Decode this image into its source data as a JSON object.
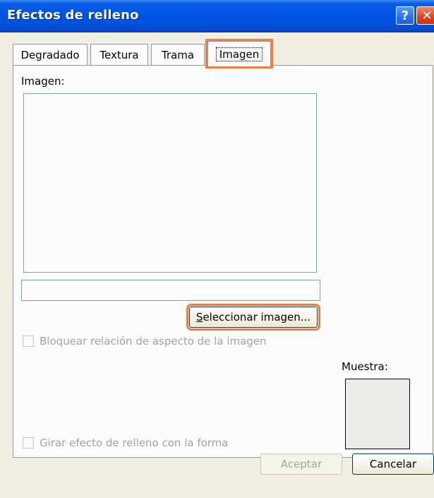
{
  "window": {
    "title": "Efectos de relleno",
    "help_label": "?",
    "close_label": "✕"
  },
  "tabs": [
    {
      "label": "Degradado",
      "selected": false
    },
    {
      "label": "Textura",
      "selected": false
    },
    {
      "label": "Trama",
      "selected": false
    },
    {
      "label": "Imagen",
      "selected": true
    }
  ],
  "image_section": {
    "label": "Imagen:",
    "filename_value": "",
    "select_button_label_first": "S",
    "select_button_label_rest": "eleccionar imagen..."
  },
  "options": {
    "lock_aspect_label": "Bloquear relación de aspecto de la imagen",
    "lock_aspect_checked": false,
    "rotate_fill_label": "Girar efecto de relleno con la forma",
    "rotate_fill_checked": false
  },
  "sample": {
    "label": "Muestra:",
    "color": "#ecebe8"
  },
  "footer": {
    "ok_label": "Aceptar",
    "cancel_label": "Cancelar"
  },
  "colors": {
    "titlebar": "#0054e3",
    "dialog_bg": "#f1efe2",
    "highlight": "#f47b3c"
  }
}
